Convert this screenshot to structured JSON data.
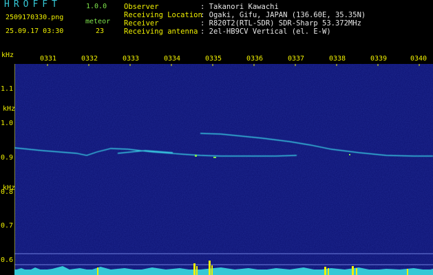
{
  "header": {
    "brand": "HROFFT",
    "version": "1.0.0",
    "filename": "2509170330.png",
    "datetime": "25.09.17 03:30",
    "meteor_label": "meteor",
    "meteor_count": "23"
  },
  "info": [
    {
      "label": "Observer",
      "value": ": Takanori Kawachi"
    },
    {
      "label": "Receiving Location",
      "value": ": Ogaki, Gifu, JAPAN (136.60E, 35.35N)"
    },
    {
      "label": "Receiver",
      "value": ": R820T2(RTL-SDR) SDR-Sharp 53.372MHz"
    },
    {
      "label": "Receiving antenna",
      "value": ": 2el-HB9CV Vertical (el. E-W)"
    }
  ],
  "axis": {
    "unit_top": "kHz",
    "unit_mid": "kHz",
    "unit_low": "kHz",
    "y_ticks": [
      "1.1",
      "1.0",
      "0.9",
      "0.8",
      "0.7",
      "0.6"
    ],
    "x_ticks": [
      "0331",
      "0332",
      "0333",
      "0334",
      "0335",
      "0336",
      "0337",
      "0338",
      "0339",
      "0340"
    ]
  },
  "colors": {
    "background": "#000000",
    "spectrogram_bg": "#0a0f6e",
    "signal": "#37c8e0",
    "label_green": "#7fe54a",
    "label_yellow": "#f0f000"
  }
}
